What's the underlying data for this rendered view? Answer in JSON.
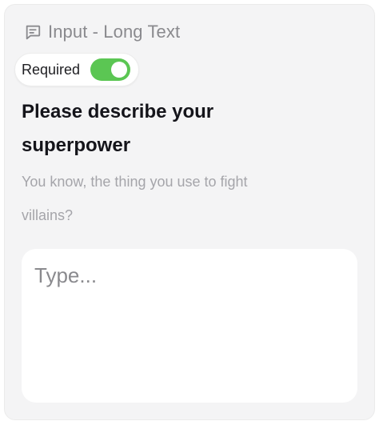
{
  "card": {
    "header": {
      "icon": "message-square-text-icon",
      "title": "Input - Long Text"
    },
    "required": {
      "label": "Required",
      "enabled": true,
      "toggle_color": "#5bc653"
    },
    "question": {
      "line1": "Please describe your",
      "line2": "superpower"
    },
    "description": {
      "line1": "You know, the thing you use to fight",
      "line2": "villains?"
    },
    "input": {
      "placeholder": "Type..."
    }
  }
}
